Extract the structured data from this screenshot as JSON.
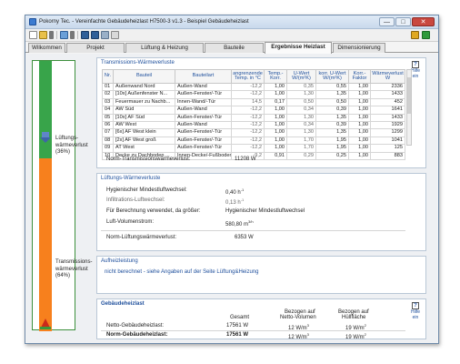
{
  "window": {
    "title": "Pokorny Tec. - Vereinfachte Gebäudeheizlast H7500-3 v1.3 - Beispiel Gebäudeheizlast",
    "min": "—",
    "max": "□",
    "close": "✕"
  },
  "tabs": [
    {
      "label": "Wilkommen"
    },
    {
      "label": "Projekt"
    },
    {
      "label": "Lüftung & Heizung"
    },
    {
      "label": "Bauteile"
    },
    {
      "label": "Ergebnisse Heizlast"
    },
    {
      "label": "Dimensionierung"
    }
  ],
  "sidebar": {
    "ventilation_label": "Lüftungs-\nwärmeverlust\n(36%)",
    "transmission_label": "Transmissions-\nwärmeverlust\n(64%)",
    "ventilation_share": 0.36,
    "transmission_share": 0.64,
    "colors": {
      "ventilation": "#38a44a",
      "transmission": "#f7801d"
    }
  },
  "help": {
    "box": "?",
    "label": "Hilfe ein"
  },
  "transmission": {
    "title": "Transmissions-Wärmeverluste",
    "columns": [
      "Nr.",
      "Bauteil",
      "Bauteilart",
      "angrenzende Temp. in °C",
      "Temp.-Korr.",
      "U-Wert W/(m²K)",
      "korr. U-Wert W/(m²K)",
      "Korr.-Faktor",
      "Wärmeverlust W"
    ],
    "rows": [
      [
        "01",
        "Außenwand Nord",
        "Außen-Wand",
        "-12,2",
        "1,00",
        "0,35",
        "0,55",
        "1,00",
        "2336"
      ],
      [
        "02",
        "[10x] Außenfenster N...",
        "Außen-Fenster/-Tür",
        "-12,2",
        "1,00",
        "1,30",
        "1,35",
        "1,00",
        "1433"
      ],
      [
        "03",
        "Feuermauer zu Nachb...",
        "Innen-Wand/-Tür",
        "14,5",
        "0,17",
        "0,50",
        "0,50",
        "1,00",
        "452"
      ],
      [
        "04",
        "AW Süd",
        "Außen-Wand",
        "-12,2",
        "1,00",
        "0,34",
        "0,39",
        "1,00",
        "1641"
      ],
      [
        "05",
        "[10x] AF Süd",
        "Außen-Fenster/-Tür",
        "-12,2",
        "1,00",
        "1,30",
        "1,35",
        "1,00",
        "1433"
      ],
      [
        "06",
        "AW West",
        "Außen-Wand",
        "-12,2",
        "1,00",
        "0,34",
        "0,39",
        "1,00",
        "1929"
      ],
      [
        "07",
        "[6x] AF West klein",
        "Außen-Fenster/-Tür",
        "-12,2",
        "1,00",
        "1,30",
        "1,35",
        "1,00",
        "1299"
      ],
      [
        "08",
        "[2x] AF West groß",
        "Außen-Fenster/-Tür",
        "-12,2",
        "1,00",
        "1,70",
        "1,95",
        "1,00",
        "1041"
      ],
      [
        "09",
        "AT West",
        "Außen-Fenster/-Tür",
        "-12,2",
        "1,00",
        "1,70",
        "1,95",
        "1,00",
        "125"
      ],
      [
        "10",
        "Decke zu Dachboden ...",
        "Innen-Decke/-Fußboden",
        "-9,2",
        "0,91",
        "0,29",
        "0,25",
        "1,00",
        "883"
      ]
    ],
    "total_label": "Norm-Transmissionswärmeverlust:",
    "total_value": "11208 W"
  },
  "ventilation": {
    "title": "Lüftungs-Wärmeverluste",
    "air_change_label": "Hygienischer Mindestluftwechsel:",
    "air_change_value": "0,40 h",
    "air_change_unit": "-1",
    "infiltration_label": "Infiltrations-Luftwechsel:",
    "infiltration_value": "0,13 h",
    "infiltration_unit": "-1",
    "basis_label": "Für Berechnung verwendet, da größer:",
    "basis_value": "Hygienischer Mindestluftwechsel",
    "flow_label": "Luft-Volumenstrom:",
    "flow_value": "580,80 m",
    "flow_unit": "3/h",
    "total_label": "Norm-Lüftungswärmeverlust:",
    "total_value": "6353 W"
  },
  "heating": {
    "title": "Aufheizleistung",
    "note": "nicht berechnet - siehe Angaben auf der Seite Lüftung&Heizung"
  },
  "building": {
    "title": "Gebäudeheizlast",
    "col_total": "Gesamt",
    "col_net_line1": "Bezogen auf",
    "col_net_line2": "Netto-Volumen",
    "col_area_line1": "Bezogen auf",
    "col_area_line2": "Hüllfläche",
    "net_label": "Netto-Gebäudeheizlast:",
    "net_total": "17561 W",
    "net_per_volume": "12 W/m",
    "net_per_volume_unit": "3",
    "net_per_area": "19 W/m",
    "net_per_area_unit": "2",
    "norm_label": "Norm-Gebäudeheizlast:",
    "norm_total": "17561 W",
    "norm_per_volume": "12 W/m",
    "norm_per_volume_unit": "3",
    "norm_per_area": "19 W/m",
    "norm_per_area_unit": "2"
  }
}
